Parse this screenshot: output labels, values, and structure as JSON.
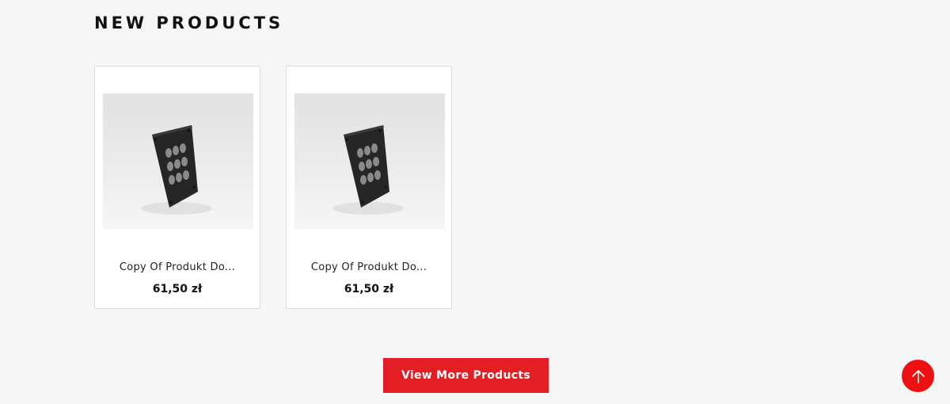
{
  "section": {
    "title": "NEW PRODUCTS"
  },
  "products": [
    {
      "name": "Copy Of Produkt Do...",
      "price": "61,50 zł",
      "image_icon": "keypad-panel-image"
    },
    {
      "name": "Copy Of Produkt Do...",
      "price": "61,50 zł",
      "image_icon": "keypad-panel-image"
    }
  ],
  "actions": {
    "view_more_label": "View More Products",
    "back_to_top_icon": "arrow-up-icon"
  },
  "colors": {
    "accent": "#e31e24",
    "back_to_top": "#ee1111",
    "background": "#f6f6f6",
    "card_background": "#ffffff"
  }
}
